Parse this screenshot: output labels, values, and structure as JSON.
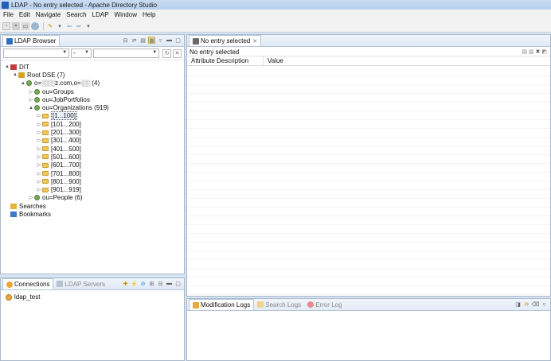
{
  "window": {
    "title": "LDAP - No entry selected - Apache Directory Studio"
  },
  "menu": [
    "File",
    "Edit",
    "Navigate",
    "Search",
    "LDAP",
    "Window",
    "Help"
  ],
  "toolbar": {
    "icons": [
      "new-icon",
      "save-icon",
      "print-icon",
      "ldap-icon",
      "tool-icon",
      "back-icon",
      "forward-icon"
    ]
  },
  "ldap_browser": {
    "tab_label": "LDAP Browser",
    "filter": {
      "combo1": "",
      "combo2": "-",
      "combo3": ""
    },
    "tree": [
      {
        "label": "DIT",
        "level": 0,
        "twisty": "▲",
        "kind": "dit"
      },
      {
        "label": "Root DSE (7)",
        "level": 1,
        "twisty": "▲",
        "kind": "root"
      },
      {
        "label": "o=░░░z.com,o=░░ (4)",
        "level": 2,
        "twisty": "▲",
        "kind": "entry"
      },
      {
        "label": "ou=Groups",
        "level": 3,
        "twisty": "▷",
        "kind": "entry"
      },
      {
        "label": "ou=JobPortfolios",
        "level": 3,
        "twisty": "▷",
        "kind": "entry"
      },
      {
        "label": "ou=Organizations (919)",
        "level": 3,
        "twisty": "▲",
        "kind": "entry"
      },
      {
        "label": "[1...100]",
        "level": 4,
        "twisty": "▷",
        "kind": "folder",
        "selected": true
      },
      {
        "label": "[101...200]",
        "level": 4,
        "twisty": "▷",
        "kind": "folder"
      },
      {
        "label": "[201...300]",
        "level": 4,
        "twisty": "▷",
        "kind": "folder"
      },
      {
        "label": "[301...400]",
        "level": 4,
        "twisty": "▷",
        "kind": "folder"
      },
      {
        "label": "[401...500]",
        "level": 4,
        "twisty": "▷",
        "kind": "folder"
      },
      {
        "label": "[501...600]",
        "level": 4,
        "twisty": "▷",
        "kind": "folder"
      },
      {
        "label": "[601...700]",
        "level": 4,
        "twisty": "▷",
        "kind": "folder"
      },
      {
        "label": "[701...800]",
        "level": 4,
        "twisty": "▷",
        "kind": "folder"
      },
      {
        "label": "[801...900]",
        "level": 4,
        "twisty": "▷",
        "kind": "folder"
      },
      {
        "label": "[901...919]",
        "level": 4,
        "twisty": "▷",
        "kind": "folder"
      },
      {
        "label": "ou=People (6)",
        "level": 3,
        "twisty": "▷",
        "kind": "entry"
      },
      {
        "label": "Searches",
        "level": 0,
        "twisty": "",
        "kind": "searches"
      },
      {
        "label": "Bookmarks",
        "level": 0,
        "twisty": "",
        "kind": "bookmarks"
      }
    ]
  },
  "connections": {
    "tab_label": "Connections",
    "tab2_label": "LDAP Servers",
    "items": [
      "ldap_test"
    ]
  },
  "entry_editor": {
    "tab_label": "No entry selected",
    "title": "No entry selected",
    "columns": [
      "Attribute Description",
      "Value"
    ]
  },
  "bottom_tabs": {
    "modification_logs": "Modification Logs",
    "search_logs": "Search Logs",
    "error_log": "Error Log"
  },
  "colors": {
    "accent": "#1f5fb5",
    "panel_border": "#a9b8ca",
    "background": "#d6e4f3"
  }
}
